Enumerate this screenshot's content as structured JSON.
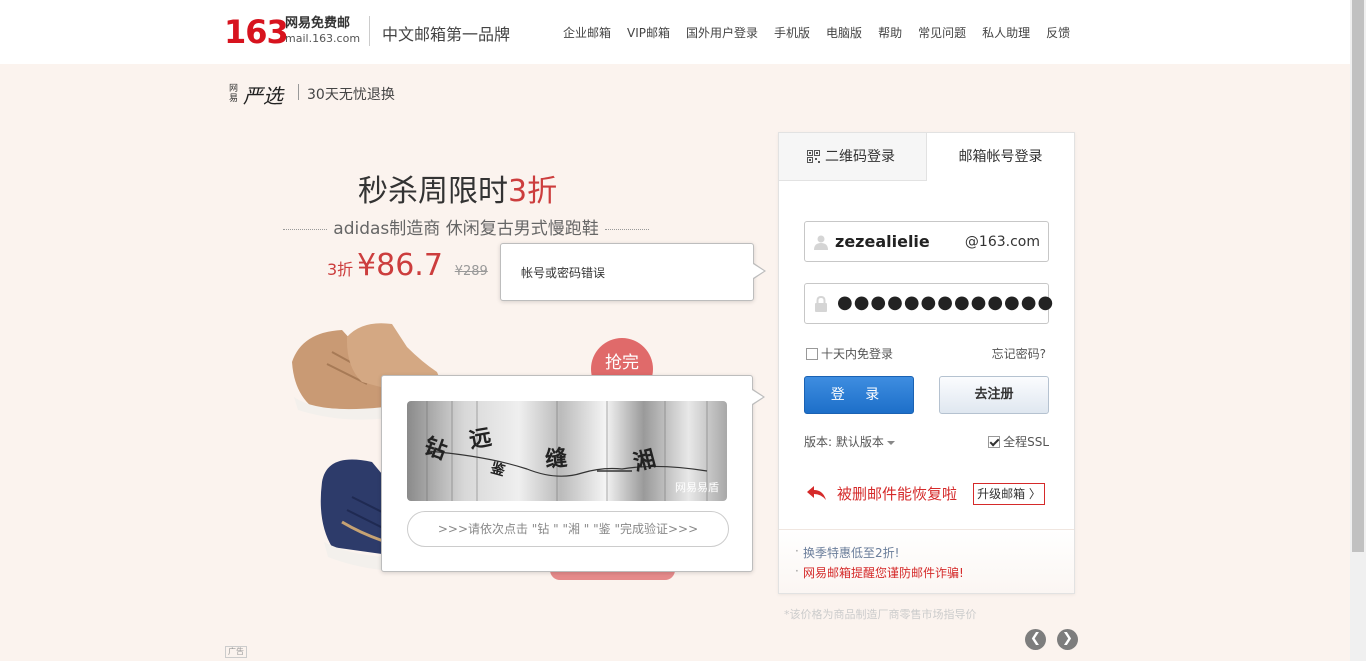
{
  "header": {
    "logo_num": "163",
    "logo_cn": "网易免费邮",
    "logo_en": "mail.163.com",
    "slogan": "中文邮箱第一品牌",
    "nav": [
      "企业邮箱",
      "VIP邮箱",
      "国外用户登录",
      "手机版",
      "电脑版",
      "帮助",
      "常见问题",
      "私人助理",
      "反馈"
    ]
  },
  "yanxuan": {
    "small": "网易",
    "logo": "严选",
    "tagline": "30天无忧退换"
  },
  "promo": {
    "title_main": "秒杀周限时",
    "title_red": "3折",
    "subtitle": "adidas制造商 休闲复古男式慢跑鞋",
    "discount": "3折",
    "price": "¥86.7",
    "original_price": "¥289",
    "stamp": "抢完"
  },
  "error_tooltip": {
    "text": "帐号或密码错误"
  },
  "captcha": {
    "chars": [
      "钻",
      "远",
      "鉴",
      "缝",
      "湘"
    ],
    "watermark": "网易易盾",
    "hint": ">>>请依次点击 \"钻 \" \"湘 \" \"鉴 \"完成验证>>>"
  },
  "login": {
    "tab_qr": "二维码登录",
    "tab_account": "邮箱帐号登录",
    "username": "zezealielie",
    "domain": "@163.com",
    "password_mask": "●●●●●●●●●●●●●",
    "remember_label": "十天内免登录",
    "forgot": "忘记密码?",
    "login_btn": "登 录",
    "register_btn": "去注册",
    "version": "版本: 默认版本",
    "ssl": "全程SSL",
    "recover_text": "被删邮件能恢复啦",
    "upgrade_btn": "升级邮箱 〉",
    "foot1": "换季特惠低至2折!",
    "foot2": "网易邮箱提醒您谨防邮件诈骗!"
  },
  "disclaimer": "*该价格为商品制造厂商零售市场指导价",
  "ad_label": "广告",
  "colors": {
    "brand_red": "#d7131e",
    "login_blue": "#1d6fc9",
    "page_bg": "#fbf3ee"
  }
}
